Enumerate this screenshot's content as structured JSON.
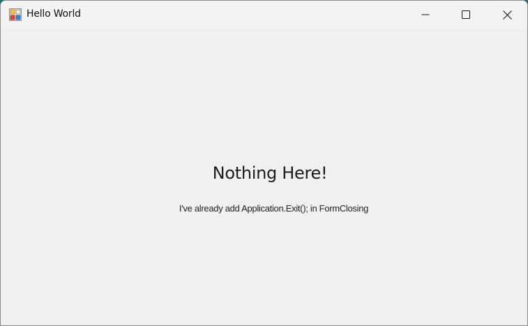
{
  "window": {
    "title": "Hello World",
    "app_icon": "winforms-app-icon",
    "controls": {
      "minimize_icon": "minimize-icon",
      "maximize_icon": "maximize-icon",
      "close_icon": "close-icon"
    }
  },
  "main": {
    "heading": "Nothing Here!",
    "message": "I've already add Application.Exit(); in FormClosing"
  },
  "colors": {
    "window_background": "#f0f0f0",
    "titlebar_background": "#f3f3f3",
    "desktop_accent": "#1aa58f"
  }
}
